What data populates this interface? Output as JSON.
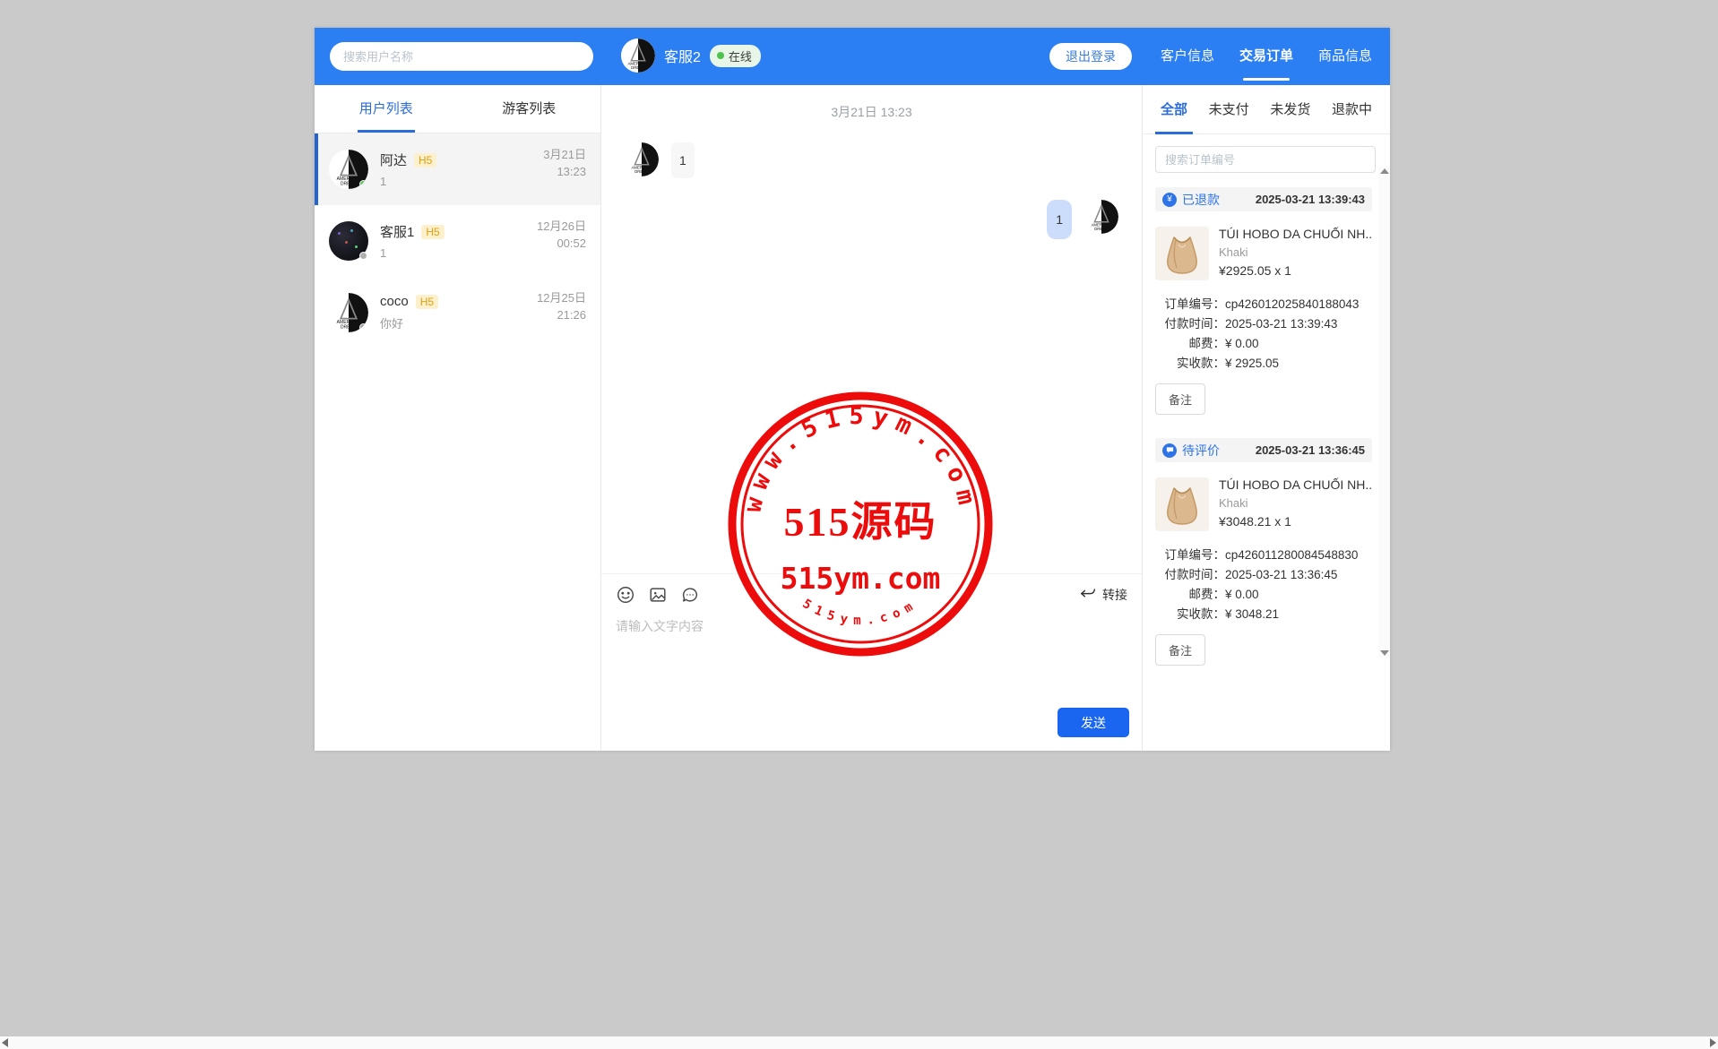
{
  "header": {
    "search_placeholder": "搜索用户名称",
    "agent_name": "客服2",
    "online_label": "在线",
    "logout_label": "退出登录",
    "nav": [
      {
        "label": "客户信息"
      },
      {
        "label": "交易订单"
      },
      {
        "label": "商品信息"
      }
    ]
  },
  "sidebar": {
    "tabs": [
      {
        "label": "用户列表"
      },
      {
        "label": "游客列表"
      }
    ],
    "users": [
      {
        "name": "阿达",
        "badge": "H5",
        "preview": "1",
        "time": "3月21日\n13:23"
      },
      {
        "name": "客服1",
        "badge": "H5",
        "preview": "1",
        "time": "12月26日\n00:52"
      },
      {
        "name": "coco",
        "badge": "H5",
        "preview": "你好",
        "time": "12月25日\n21:26"
      }
    ]
  },
  "chat": {
    "date_label": "3月21日 13:23",
    "incoming_message": "1",
    "outgoing_message": "1",
    "transfer_label": "转接",
    "input_placeholder": "请输入文字内容",
    "send_label": "发送"
  },
  "orders_panel": {
    "tabs": [
      {
        "label": "全部"
      },
      {
        "label": "未支付"
      },
      {
        "label": "未发货"
      },
      {
        "label": "退款中"
      }
    ],
    "search_placeholder": "搜索订单编号",
    "orders": [
      {
        "status": "已退款",
        "timestamp": "2025-03-21 13:39:43",
        "product_title": "TÚI HOBO DA CHUỐI NH...",
        "variant": "Khaki",
        "price_qty": "¥2925.05 x 1",
        "fields": [
          {
            "label": "订单编号：",
            "value": "cp426012025840188043"
          },
          {
            "label": "付款时间：",
            "value": "2025-03-21 13:39:43"
          },
          {
            "label": "邮费：",
            "value": "¥ 0.00"
          },
          {
            "label": "实收款：",
            "value": "¥ 2925.05"
          }
        ],
        "note_label": "备注"
      },
      {
        "status": "待评价",
        "timestamp": "2025-03-21 13:36:45",
        "product_title": "TÚI HOBO DA CHUỐI NH...",
        "variant": "Khaki",
        "price_qty": "¥3048.21 x 1",
        "fields": [
          {
            "label": "订单编号：",
            "value": "cp426011280084548830"
          },
          {
            "label": "付款时间：",
            "value": "2025-03-21 13:36:45"
          },
          {
            "label": "邮费：",
            "value": "¥ 0.00"
          },
          {
            "label": "实收款：",
            "value": "¥ 3048.21"
          }
        ],
        "note_label": "备注"
      }
    ]
  },
  "watermark": {
    "arc_top": "www.515ym.com",
    "center_line1": "515源码",
    "center_line2": "515ym.com",
    "arc_bottom": "515ym.com",
    "color": "#ed0000"
  },
  "colors": {
    "header_blue": "#2b7ff2",
    "accent_blue": "#2b6cd9",
    "send_blue": "#1a66f0",
    "status_blue": "#2e74e8",
    "online_green": "#4fc24f"
  }
}
